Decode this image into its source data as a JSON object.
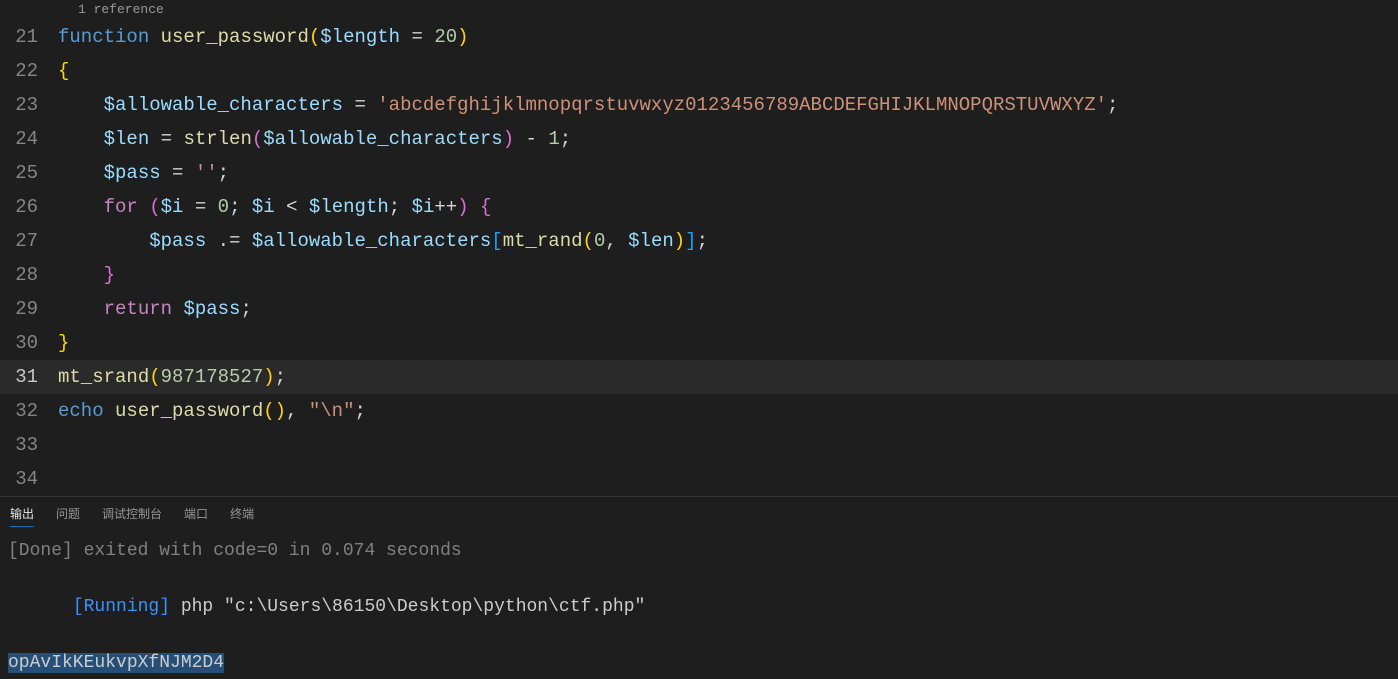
{
  "codelens": "1 reference",
  "lines": [
    {
      "num": "21",
      "tokens": [
        [
          "keyword",
          "function"
        ],
        [
          "punctuation",
          " "
        ],
        [
          "function",
          "user_password"
        ],
        [
          "brace",
          "("
        ],
        [
          "variable",
          "$length"
        ],
        [
          "punctuation",
          " = "
        ],
        [
          "number",
          "20"
        ],
        [
          "brace",
          ")"
        ]
      ]
    },
    {
      "num": "22",
      "tokens": [
        [
          "brace",
          "{"
        ]
      ]
    },
    {
      "num": "23",
      "tokens": [
        [
          "punctuation",
          "    "
        ],
        [
          "variable",
          "$allowable_characters"
        ],
        [
          "punctuation",
          " = "
        ],
        [
          "string",
          "'abcdefghijklmnopqrstuvwxyz0123456789ABCDEFGHIJKLMNOPQRSTUVWXYZ'"
        ],
        [
          "punctuation",
          ";"
        ]
      ]
    },
    {
      "num": "24",
      "tokens": [
        [
          "punctuation",
          "    "
        ],
        [
          "variable",
          "$len"
        ],
        [
          "punctuation",
          " = "
        ],
        [
          "function",
          "strlen"
        ],
        [
          "bracket-purple",
          "("
        ],
        [
          "variable",
          "$allowable_characters"
        ],
        [
          "bracket-purple",
          ")"
        ],
        [
          "punctuation",
          " - "
        ],
        [
          "number",
          "1"
        ],
        [
          "punctuation",
          ";"
        ]
      ]
    },
    {
      "num": "25",
      "tokens": [
        [
          "punctuation",
          "    "
        ],
        [
          "variable",
          "$pass"
        ],
        [
          "punctuation",
          " = "
        ],
        [
          "string",
          "''"
        ],
        [
          "punctuation",
          ";"
        ]
      ]
    },
    {
      "num": "26",
      "tokens": [
        [
          "punctuation",
          "    "
        ],
        [
          "control",
          "for"
        ],
        [
          "punctuation",
          " "
        ],
        [
          "bracket-purple",
          "("
        ],
        [
          "variable",
          "$i"
        ],
        [
          "punctuation",
          " = "
        ],
        [
          "number",
          "0"
        ],
        [
          "punctuation",
          "; "
        ],
        [
          "variable",
          "$i"
        ],
        [
          "punctuation",
          " < "
        ],
        [
          "variable",
          "$length"
        ],
        [
          "punctuation",
          "; "
        ],
        [
          "variable",
          "$i"
        ],
        [
          "punctuation",
          "++"
        ],
        [
          "bracket-purple",
          ")"
        ],
        [
          "punctuation",
          " "
        ],
        [
          "bracket-purple",
          "{"
        ]
      ]
    },
    {
      "num": "27",
      "tokens": [
        [
          "punctuation",
          "        "
        ],
        [
          "variable",
          "$pass"
        ],
        [
          "punctuation",
          " .= "
        ],
        [
          "variable",
          "$allowable_characters"
        ],
        [
          "bracket-blue",
          "["
        ],
        [
          "function",
          "mt_rand"
        ],
        [
          "brace",
          "("
        ],
        [
          "number",
          "0"
        ],
        [
          "punctuation",
          ", "
        ],
        [
          "variable",
          "$len"
        ],
        [
          "brace",
          ")"
        ],
        [
          "bracket-blue",
          "]"
        ],
        [
          "punctuation",
          ";"
        ]
      ]
    },
    {
      "num": "28",
      "tokens": [
        [
          "punctuation",
          "    "
        ],
        [
          "bracket-purple",
          "}"
        ]
      ]
    },
    {
      "num": "29",
      "tokens": [
        [
          "punctuation",
          "    "
        ],
        [
          "control",
          "return"
        ],
        [
          "punctuation",
          " "
        ],
        [
          "variable",
          "$pass"
        ],
        [
          "punctuation",
          ";"
        ]
      ]
    },
    {
      "num": "30",
      "tokens": [
        [
          "brace",
          "}"
        ]
      ]
    },
    {
      "num": "31",
      "current": true,
      "tokens": [
        [
          "function",
          "mt_srand"
        ],
        [
          "brace",
          "("
        ],
        [
          "number",
          "987178527"
        ],
        [
          "brace",
          ")"
        ],
        [
          "punctuation",
          ";"
        ]
      ]
    },
    {
      "num": "32",
      "tokens": [
        [
          "keyword",
          "echo"
        ],
        [
          "punctuation",
          " "
        ],
        [
          "function",
          "user_password"
        ],
        [
          "brace",
          "("
        ],
        [
          "brace",
          ")"
        ],
        [
          "punctuation",
          ", "
        ],
        [
          "string",
          "\"\\n\""
        ],
        [
          "punctuation",
          ";"
        ]
      ]
    },
    {
      "num": "33",
      "tokens": []
    },
    {
      "num": "34",
      "tokens": []
    }
  ],
  "panel": {
    "tabs": [
      "输出",
      "问题",
      "调试控制台",
      "端口",
      "终端"
    ],
    "active_tab": 0,
    "output": {
      "done_line": "[Done] exited with code=0 in 0.074 seconds",
      "blank_line": "",
      "running_prefix": "[Running]",
      "running_rest": " php \"c:\\Users\\86150\\Desktop\\python\\ctf.php\"",
      "result": "opAvIkKEukvpXfNJM2D4"
    }
  }
}
